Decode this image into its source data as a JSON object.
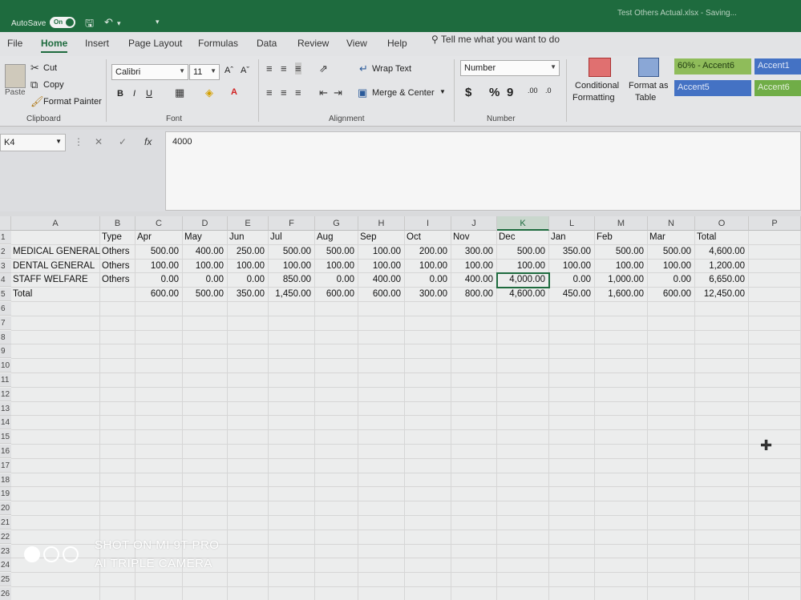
{
  "titlebar": {
    "autosave_label": "AutoSave",
    "autosave_state": "On",
    "document_title": "Test Others Actual.xlsx - Saving..."
  },
  "menu": {
    "tabs": [
      "File",
      "Home",
      "Insert",
      "Page Layout",
      "Formulas",
      "Data",
      "Review",
      "View",
      "Help"
    ],
    "active_tab": "Home",
    "tell_me": "Tell me what you want to do"
  },
  "ribbon": {
    "clipboard": {
      "paste": "Paste",
      "cut": "Cut",
      "copy": "Copy",
      "format_painter": "Format Painter",
      "label": "Clipboard"
    },
    "font": {
      "name": "Calibri",
      "size": "11",
      "label": "Font"
    },
    "alignment": {
      "wrap_text": "Wrap Text",
      "merge_center": "Merge & Center",
      "label": "Alignment"
    },
    "number": {
      "format": "Number",
      "label": "Number"
    },
    "styles": {
      "conditional_formatting_1": "Conditional",
      "conditional_formatting_2": "Formatting",
      "format_as_table_1": "Format as",
      "format_as_table_2": "Table",
      "accent6_60": "60% - Accent6",
      "accent1": "Accent1",
      "accent5": "Accent5",
      "accent6": "Accent6"
    },
    "colors": {
      "accent6_60": "#8fbc5a",
      "accent1": "#4472c4",
      "accent5": "#4472c4",
      "accent6": "#70ad47"
    }
  },
  "formula_bar": {
    "name_box": "K4",
    "value": "4000"
  },
  "sheet": {
    "columns": [
      "A",
      "B",
      "C",
      "D",
      "E",
      "F",
      "G",
      "H",
      "I",
      "J",
      "K",
      "L",
      "M",
      "N",
      "O",
      "P"
    ],
    "row_numbers": [
      "1",
      "2",
      "3",
      "4",
      "5",
      "6",
      "7",
      "8",
      "9",
      "10",
      "11",
      "12",
      "13",
      "14",
      "15",
      "16",
      "17",
      "18",
      "19",
      "20",
      "21",
      "22",
      "23",
      "24",
      "25",
      "26"
    ],
    "header_row": [
      "",
      "Type",
      "Apr",
      "May",
      "Jun",
      "Jul",
      "Aug",
      "Sep",
      "Oct",
      "Nov",
      "Dec",
      "Jan",
      "Feb",
      "Mar",
      "Total"
    ],
    "rows": [
      [
        "MEDICAL GENERAL",
        "Others",
        "500.00",
        "400.00",
        "250.00",
        "500.00",
        "500.00",
        "100.00",
        "200.00",
        "300.00",
        "500.00",
        "350.00",
        "500.00",
        "500.00",
        "4,600.00"
      ],
      [
        "DENTAL GENERAL",
        "Others",
        "100.00",
        "100.00",
        "100.00",
        "100.00",
        "100.00",
        "100.00",
        "100.00",
        "100.00",
        "100.00",
        "100.00",
        "100.00",
        "100.00",
        "1,200.00"
      ],
      [
        "STAFF WELFARE",
        "Others",
        "0.00",
        "0.00",
        "0.00",
        "850.00",
        "0.00",
        "400.00",
        "0.00",
        "400.00",
        "4,000.00",
        "0.00",
        "1,000.00",
        "0.00",
        "6,650.00"
      ],
      [
        "Total",
        "",
        "600.00",
        "500.00",
        "350.00",
        "1,450.00",
        "600.00",
        "600.00",
        "300.00",
        "800.00",
        "4,600.00",
        "450.00",
        "1,600.00",
        "600.00",
        "12,450.00"
      ]
    ],
    "active_cell": "K4"
  },
  "watermark": {
    "line1": "SHOT ON MI 9T PRO",
    "line2": "AI TRIPLE CAMERA"
  }
}
